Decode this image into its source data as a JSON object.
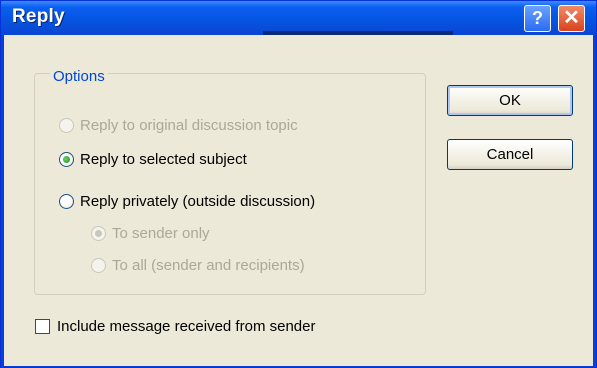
{
  "window": {
    "title": "Reply",
    "help_glyph": "?",
    "close_glyph": "✕"
  },
  "options": {
    "legend": "Options",
    "items": [
      {
        "label": "Reply to original discussion topic",
        "selected": false,
        "enabled": false
      },
      {
        "label": "Reply to selected subject",
        "selected": true,
        "enabled": true
      },
      {
        "label": "Reply privately (outside discussion)",
        "selected": false,
        "enabled": true
      }
    ],
    "sub_items": [
      {
        "label": "To sender only",
        "selected": true,
        "enabled": false
      },
      {
        "label": "To all (sender and recipients)",
        "selected": false,
        "enabled": false
      }
    ]
  },
  "include": {
    "label": "Include message received from sender",
    "checked": false
  },
  "buttons": {
    "ok": "OK",
    "cancel": "Cancel"
  },
  "colors": {
    "titlebar": "#0553e0",
    "body": "#ece9d8",
    "legend": "#0046d5",
    "disabled_text": "#aca899"
  }
}
